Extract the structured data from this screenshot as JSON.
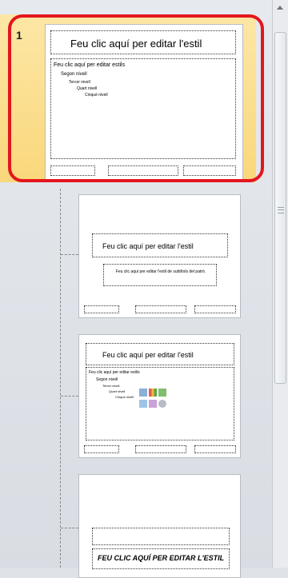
{
  "master": {
    "slide_number": "1",
    "title": "Feu clic aquí per editar l'estil",
    "bullets": [
      "Feu clic aquí per editar estils",
      "Segon nivell",
      "Tercer nivell",
      "Quart nivell",
      "Cinquè nivell"
    ]
  },
  "layouts": [
    {
      "title": "Feu clic aquí per editar l'estil",
      "subtitle": "Feu clic aquí per editar l'estil de subtítols del patró."
    },
    {
      "title": "Feu clic aquí per editar l'estil",
      "bullets": [
        "Feu clic aquí per editar estils",
        "Segon nivell",
        "Tercer nivell",
        "Quart nivell",
        "Cinquè nivell"
      ]
    },
    {
      "title": "FEU CLIC AQUÍ PER EDITAR L'ESTIL"
    }
  ],
  "colors": {
    "selection_outline": "#e3161d",
    "selection_fill": "#fbe08f"
  }
}
